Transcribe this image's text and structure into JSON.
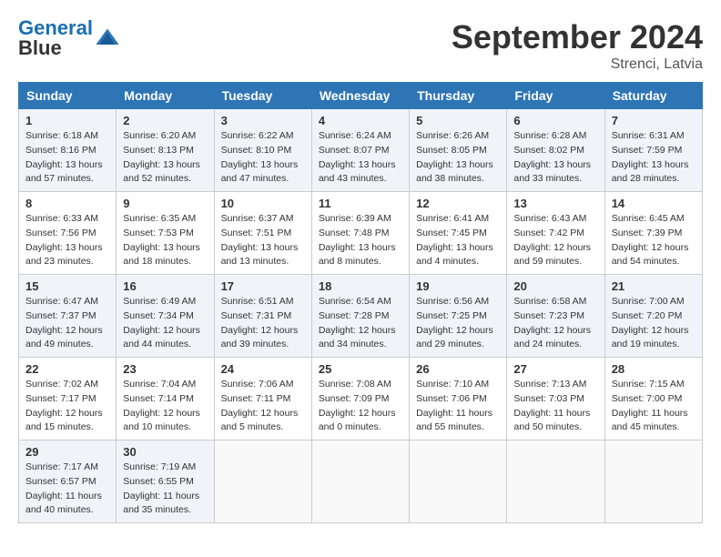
{
  "header": {
    "logo_general": "General",
    "logo_blue": "Blue",
    "month_title": "September 2024",
    "location": "Strenci, Latvia"
  },
  "weekdays": [
    "Sunday",
    "Monday",
    "Tuesday",
    "Wednesday",
    "Thursday",
    "Friday",
    "Saturday"
  ],
  "weeks": [
    [
      {
        "day": "1",
        "sunrise": "Sunrise: 6:18 AM",
        "sunset": "Sunset: 8:16 PM",
        "daylight": "Daylight: 13 hours and 57 minutes."
      },
      {
        "day": "2",
        "sunrise": "Sunrise: 6:20 AM",
        "sunset": "Sunset: 8:13 PM",
        "daylight": "Daylight: 13 hours and 52 minutes."
      },
      {
        "day": "3",
        "sunrise": "Sunrise: 6:22 AM",
        "sunset": "Sunset: 8:10 PM",
        "daylight": "Daylight: 13 hours and 47 minutes."
      },
      {
        "day": "4",
        "sunrise": "Sunrise: 6:24 AM",
        "sunset": "Sunset: 8:07 PM",
        "daylight": "Daylight: 13 hours and 43 minutes."
      },
      {
        "day": "5",
        "sunrise": "Sunrise: 6:26 AM",
        "sunset": "Sunset: 8:05 PM",
        "daylight": "Daylight: 13 hours and 38 minutes."
      },
      {
        "day": "6",
        "sunrise": "Sunrise: 6:28 AM",
        "sunset": "Sunset: 8:02 PM",
        "daylight": "Daylight: 13 hours and 33 minutes."
      },
      {
        "day": "7",
        "sunrise": "Sunrise: 6:31 AM",
        "sunset": "Sunset: 7:59 PM",
        "daylight": "Daylight: 13 hours and 28 minutes."
      }
    ],
    [
      {
        "day": "8",
        "sunrise": "Sunrise: 6:33 AM",
        "sunset": "Sunset: 7:56 PM",
        "daylight": "Daylight: 13 hours and 23 minutes."
      },
      {
        "day": "9",
        "sunrise": "Sunrise: 6:35 AM",
        "sunset": "Sunset: 7:53 PM",
        "daylight": "Daylight: 13 hours and 18 minutes."
      },
      {
        "day": "10",
        "sunrise": "Sunrise: 6:37 AM",
        "sunset": "Sunset: 7:51 PM",
        "daylight": "Daylight: 13 hours and 13 minutes."
      },
      {
        "day": "11",
        "sunrise": "Sunrise: 6:39 AM",
        "sunset": "Sunset: 7:48 PM",
        "daylight": "Daylight: 13 hours and 8 minutes."
      },
      {
        "day": "12",
        "sunrise": "Sunrise: 6:41 AM",
        "sunset": "Sunset: 7:45 PM",
        "daylight": "Daylight: 13 hours and 4 minutes."
      },
      {
        "day": "13",
        "sunrise": "Sunrise: 6:43 AM",
        "sunset": "Sunset: 7:42 PM",
        "daylight": "Daylight: 12 hours and 59 minutes."
      },
      {
        "day": "14",
        "sunrise": "Sunrise: 6:45 AM",
        "sunset": "Sunset: 7:39 PM",
        "daylight": "Daylight: 12 hours and 54 minutes."
      }
    ],
    [
      {
        "day": "15",
        "sunrise": "Sunrise: 6:47 AM",
        "sunset": "Sunset: 7:37 PM",
        "daylight": "Daylight: 12 hours and 49 minutes."
      },
      {
        "day": "16",
        "sunrise": "Sunrise: 6:49 AM",
        "sunset": "Sunset: 7:34 PM",
        "daylight": "Daylight: 12 hours and 44 minutes."
      },
      {
        "day": "17",
        "sunrise": "Sunrise: 6:51 AM",
        "sunset": "Sunset: 7:31 PM",
        "daylight": "Daylight: 12 hours and 39 minutes."
      },
      {
        "day": "18",
        "sunrise": "Sunrise: 6:54 AM",
        "sunset": "Sunset: 7:28 PM",
        "daylight": "Daylight: 12 hours and 34 minutes."
      },
      {
        "day": "19",
        "sunrise": "Sunrise: 6:56 AM",
        "sunset": "Sunset: 7:25 PM",
        "daylight": "Daylight: 12 hours and 29 minutes."
      },
      {
        "day": "20",
        "sunrise": "Sunrise: 6:58 AM",
        "sunset": "Sunset: 7:23 PM",
        "daylight": "Daylight: 12 hours and 24 minutes."
      },
      {
        "day": "21",
        "sunrise": "Sunrise: 7:00 AM",
        "sunset": "Sunset: 7:20 PM",
        "daylight": "Daylight: 12 hours and 19 minutes."
      }
    ],
    [
      {
        "day": "22",
        "sunrise": "Sunrise: 7:02 AM",
        "sunset": "Sunset: 7:17 PM",
        "daylight": "Daylight: 12 hours and 15 minutes."
      },
      {
        "day": "23",
        "sunrise": "Sunrise: 7:04 AM",
        "sunset": "Sunset: 7:14 PM",
        "daylight": "Daylight: 12 hours and 10 minutes."
      },
      {
        "day": "24",
        "sunrise": "Sunrise: 7:06 AM",
        "sunset": "Sunset: 7:11 PM",
        "daylight": "Daylight: 12 hours and 5 minutes."
      },
      {
        "day": "25",
        "sunrise": "Sunrise: 7:08 AM",
        "sunset": "Sunset: 7:09 PM",
        "daylight": "Daylight: 12 hours and 0 minutes."
      },
      {
        "day": "26",
        "sunrise": "Sunrise: 7:10 AM",
        "sunset": "Sunset: 7:06 PM",
        "daylight": "Daylight: 11 hours and 55 minutes."
      },
      {
        "day": "27",
        "sunrise": "Sunrise: 7:13 AM",
        "sunset": "Sunset: 7:03 PM",
        "daylight": "Daylight: 11 hours and 50 minutes."
      },
      {
        "day": "28",
        "sunrise": "Sunrise: 7:15 AM",
        "sunset": "Sunset: 7:00 PM",
        "daylight": "Daylight: 11 hours and 45 minutes."
      }
    ],
    [
      {
        "day": "29",
        "sunrise": "Sunrise: 7:17 AM",
        "sunset": "Sunset: 6:57 PM",
        "daylight": "Daylight: 11 hours and 40 minutes."
      },
      {
        "day": "30",
        "sunrise": "Sunrise: 7:19 AM",
        "sunset": "Sunset: 6:55 PM",
        "daylight": "Daylight: 11 hours and 35 minutes."
      },
      null,
      null,
      null,
      null,
      null
    ]
  ]
}
